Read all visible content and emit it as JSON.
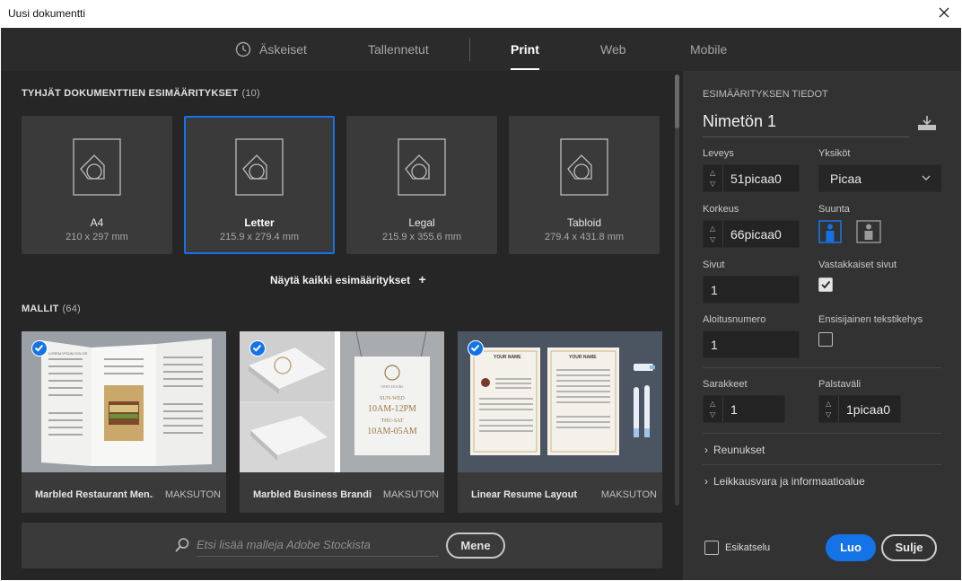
{
  "window": {
    "title": "Uusi dokumentti"
  },
  "tabs": [
    {
      "label": "Äskeiset"
    },
    {
      "label": "Tallennetut"
    },
    {
      "label": "Print"
    },
    {
      "label": "Web"
    },
    {
      "label": "Mobile"
    }
  ],
  "presets_section": {
    "title": "TYHJÄT DOKUMENTTIEN ESIMÄÄRITYKSET",
    "count": "(10)",
    "items": [
      {
        "name": "A4",
        "size": "210 x 297 mm"
      },
      {
        "name": "Letter",
        "size": "215.9 x 279.4 mm"
      },
      {
        "name": "Legal",
        "size": "215.9 x 355.6 mm"
      },
      {
        "name": "Tabloid",
        "size": "279.4 x 431.8 mm"
      }
    ],
    "show_all": "Näytä kaikki esimääritykset"
  },
  "templates_section": {
    "title": "MALLIT",
    "count": "(64)",
    "items": [
      {
        "name": "Marbled Restaurant Men...",
        "badge": "MAKSUTON"
      },
      {
        "name": "Marbled Business Brandin...",
        "badge": "MAKSUTON"
      },
      {
        "name": "Linear Resume Layout",
        "badge": "MAKSUTON"
      }
    ]
  },
  "thumbs": {
    "menu_line": "LOREM IPSUM DOLOR",
    "sign_small": "OPEN HOURS",
    "sign_line1": "SUN-WED",
    "sign_line2": "10AM-12PM",
    "sign_line3": "THU-SAT",
    "sign_line4": "10AM-05AM",
    "resume_name": "YOUR NAME"
  },
  "search": {
    "placeholder": "Etsi lisää malleja Adobe Stockista",
    "button": "Mene"
  },
  "details": {
    "header": "ESIMÄÄRITYKSEN TIEDOT",
    "doc_name": "Nimetön 1",
    "width_label": "Leveys",
    "width_value": "51picaa0",
    "units_label": "Yksiköt",
    "units_value": "Picaa",
    "height_label": "Korkeus",
    "height_value": "66picaa0",
    "orientation_label": "Suunta",
    "pages_label": "Sivut",
    "pages_value": "1",
    "facing_label": "Vastakkaiset sivut",
    "start_label": "Aloitusnumero",
    "start_value": "1",
    "primary_frame_label": "Ensisijainen tekstikehys",
    "columns_label": "Sarakkeet",
    "columns_value": "1",
    "gutter_label": "Palstaväli",
    "gutter_value": "1picaa0",
    "margins_label": "Reunukset",
    "bleed_label": "Leikkausvara ja informaatioalue",
    "preview_label": "Esikatselu",
    "create_button": "Luo",
    "close_button": "Sulje"
  },
  "colors": {
    "accent": "#1473e6",
    "panel": "#323232",
    "dark": "#262626"
  }
}
